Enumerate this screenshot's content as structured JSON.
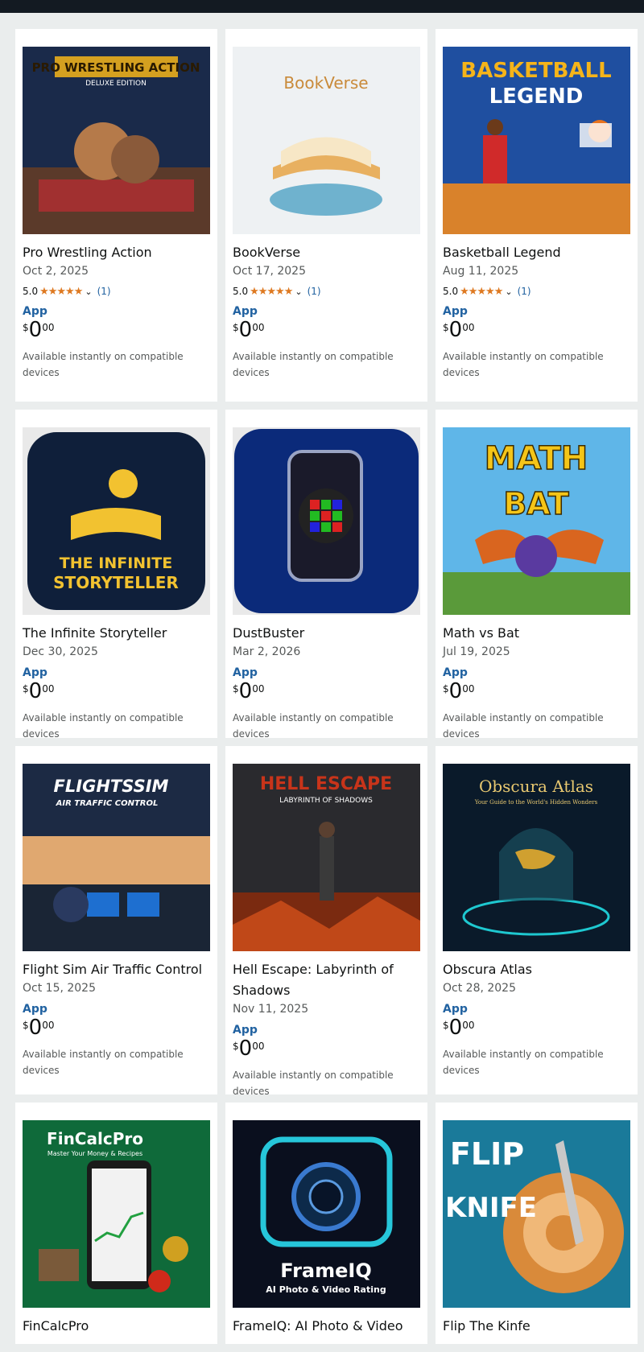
{
  "products": [
    {
      "title": "Pro Wrestling Action",
      "date": "Oct 2, 2025",
      "rating": "5.0",
      "stars": "★★★★★",
      "rating_count": "(1)",
      "type": "App",
      "price_symbol": "$",
      "price_whole": "0",
      "price_fraction": "00",
      "availability": "Available instantly on compatible devices",
      "thumb_text": "PRO WRESTLING ACTION",
      "thumb_subtext": "DELUXE EDITION"
    },
    {
      "title": "BookVerse",
      "date": "Oct 17, 2025",
      "rating": "5.0",
      "stars": "★★★★★",
      "rating_count": "(1)",
      "type": "App",
      "price_symbol": "$",
      "price_whole": "0",
      "price_fraction": "00",
      "availability": "Available instantly on compatible devices",
      "thumb_text": "BookVerse"
    },
    {
      "title": "Basketball Legend",
      "date": "Aug 11, 2025",
      "rating": "5.0",
      "stars": "★★★★★",
      "rating_count": "(1)",
      "type": "App",
      "price_symbol": "$",
      "price_whole": "0",
      "price_fraction": "00",
      "availability": "Available instantly on compatible devices",
      "thumb_text": "BASKETBALL",
      "thumb_subtext": "LEGEND"
    },
    {
      "title": "The Infinite Storyteller",
      "date": "Dec 30, 2025",
      "type": "App",
      "price_symbol": "$",
      "price_whole": "0",
      "price_fraction": "00",
      "availability": "Available instantly on compatible devices",
      "thumb_text": "THE INFINITE",
      "thumb_subtext": "STORYTELLER"
    },
    {
      "title": "DustBuster",
      "date": "Mar 2, 2026",
      "type": "App",
      "price_symbol": "$",
      "price_whole": "0",
      "price_fraction": "00",
      "availability": "Available instantly on compatible devices"
    },
    {
      "title": "Math vs Bat",
      "date": "Jul 19, 2025",
      "type": "App",
      "price_symbol": "$",
      "price_whole": "0",
      "price_fraction": "00",
      "availability": "Available instantly on compatible devices",
      "thumb_text": "MATH",
      "thumb_subtext": "BAT"
    },
    {
      "title": "Flight Sim Air Traffic Control",
      "date": "Oct 15, 2025",
      "type": "App",
      "price_symbol": "$",
      "price_whole": "0",
      "price_fraction": "00",
      "availability": "Available instantly on compatible devices",
      "thumb_text": "FLIGHTSSIM",
      "thumb_subtext": "AIR TRAFFIC CONTROL"
    },
    {
      "title": "Hell Escape: Labyrinth of Shadows",
      "date": "Nov 11, 2025",
      "type": "App",
      "price_symbol": "$",
      "price_whole": "0",
      "price_fraction": "00",
      "availability": "Available instantly on compatible devices",
      "thumb_text": "HELL ESCAPE",
      "thumb_subtext": "LABYRINTH OF SHADOWS"
    },
    {
      "title": "Obscura Atlas",
      "date": "Oct 28, 2025",
      "type": "App",
      "price_symbol": "$",
      "price_whole": "0",
      "price_fraction": "00",
      "availability": "Available instantly on compatible devices",
      "thumb_text": "Obscura Atlas",
      "thumb_subtext": "Your Guide to the World's Hidden Wonders"
    },
    {
      "title": "FinCalcPro",
      "thumb_text": "FinCalcPro",
      "thumb_subtext": "Master Your Money & Recipes"
    },
    {
      "title": "FrameIQ: AI Photo & Video",
      "thumb_text": "FrameIQ",
      "thumb_subtext": "AI Photo & Video Rating"
    },
    {
      "title": "Flip The Kinfe",
      "thumb_text": "FLIP",
      "thumb_subtext": "KNIFE"
    }
  ],
  "colors": {
    "topbar": "#131a22",
    "page_bg": "#eaeded",
    "link": "#2162a1",
    "star": "#de7921"
  }
}
